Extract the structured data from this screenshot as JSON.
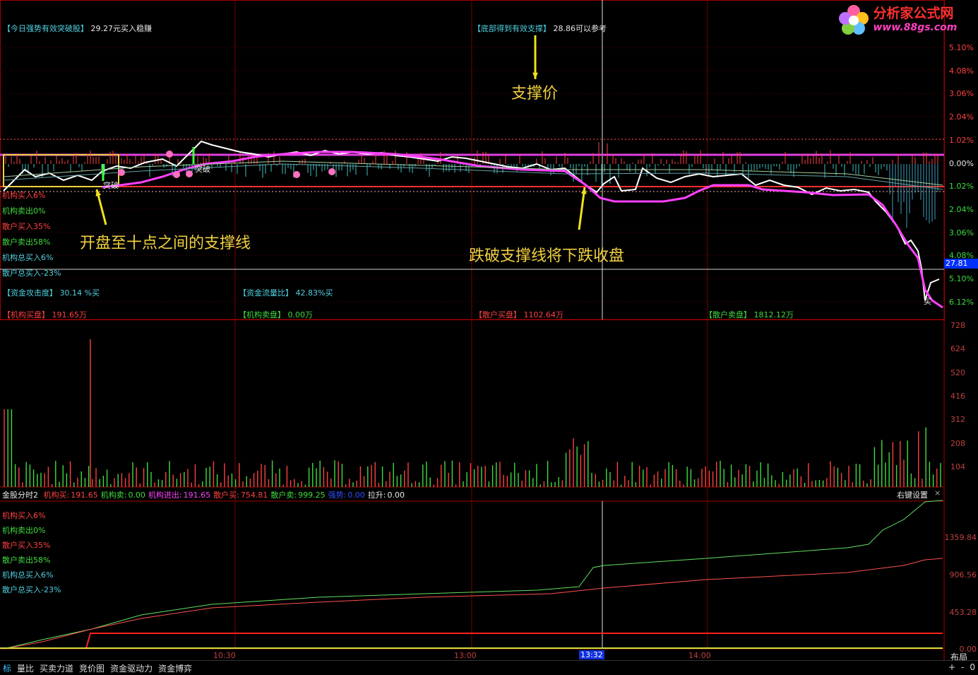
{
  "watermark": {
    "line1": "分析家公式网",
    "line2": "www.88gs.com"
  },
  "top_labels": {
    "left_key": "【今日强势有效突破股】",
    "left_val": "29.27元买入稳赚",
    "mid_key": "【底部得到有效支撑】",
    "mid_val": "28.86可以参考"
  },
  "annotations": {
    "support_price": "支撑价",
    "support_line": "开盘至十点之间的支撑线",
    "break_support": "跌破支撑线将下跌收盘",
    "tupo_1": "突破",
    "tupo_2": "突破",
    "buy_mark": "买"
  },
  "main_left_stats": [
    {
      "text": "机构买入6%",
      "color": "#ff4040"
    },
    {
      "text": "机构卖出0%",
      "color": "#3fdc3f"
    },
    {
      "text": "散户买入35%",
      "color": "#ff4040"
    },
    {
      "text": "散户卖出58%",
      "color": "#3fdc3f"
    },
    {
      "text": "机构总买入6%",
      "color": "#50d0e0"
    },
    {
      "text": "散户总买入-23%",
      "color": "#50d0e0"
    }
  ],
  "price_axis": [
    "5.10%",
    "4.08%",
    "3.06%",
    "2.04%",
    "1.02%",
    "0.00%",
    "1.02%",
    "2.04%",
    "3.06%",
    "4.08%",
    "5.10%",
    "6.12%"
  ],
  "current_price_tag": "27.81",
  "fund_row1": {
    "attack_key": "【资金攻击度】",
    "attack_val": "30.14 %买",
    "flow_key": "【资金流量比】",
    "flow_val": "42.83%买"
  },
  "fund_row2": {
    "inst_buy_key": "【机构买盘】",
    "inst_buy_val": "191.65万",
    "inst_sell_key": "【机构卖盘】",
    "inst_sell_val": "0.00万",
    "retail_buy_key": "【散户买盘】",
    "retail_buy_val": "1102.64万",
    "retail_sell_key": "【散户卖盘】",
    "retail_sell_val": "1812.12万"
  },
  "volume_axis": [
    "728",
    "624",
    "520",
    "416",
    "312",
    "208",
    "104"
  ],
  "indicator_bar": {
    "name": "金股分时2",
    "items": [
      {
        "label": "机构买:",
        "value": "191.65",
        "color": "#ff4040"
      },
      {
        "label": "机构卖:",
        "value": "0.00",
        "color": "#3fdc3f"
      },
      {
        "label": "机构进出:",
        "value": "191.65",
        "color": "#ff40ff"
      },
      {
        "label": "散户买:",
        "value": "754.81",
        "color": "#ff4040"
      },
      {
        "label": "散户卖:",
        "value": "999.25",
        "color": "#3fdc3f"
      },
      {
        "label": "强势:",
        "value": "0.00",
        "color": "#3050ff"
      },
      {
        "label": "拉升:",
        "value": "0.00",
        "color": "#e8e8e8"
      }
    ],
    "right_setting": "右键设置",
    "close": "×"
  },
  "lower_left_stats": [
    {
      "text": "机构买入6%",
      "color": "#ff4040"
    },
    {
      "text": "机构卖出0%",
      "color": "#3fdc3f"
    },
    {
      "text": "散户买入35%",
      "color": "#ff4040"
    },
    {
      "text": "散户卖出58%",
      "color": "#3fdc3f"
    },
    {
      "text": "机构总买入6%",
      "color": "#50d0e0"
    },
    {
      "text": "散户总买入-23%",
      "color": "#50d0e0"
    }
  ],
  "lower_axis": [
    "1359.84",
    "906.56",
    "453.28",
    "0.00"
  ],
  "time_axis": [
    "10:30",
    "13:00",
    "14:00"
  ],
  "time_cursor": "13:32",
  "layout_btn": "布局",
  "bottom_tabs": [
    "标",
    "量比",
    "买卖力道",
    "竞价图",
    "资金驱动力",
    "资金博弈"
  ],
  "bottom_right": [
    "+",
    "-",
    "0"
  ]
}
